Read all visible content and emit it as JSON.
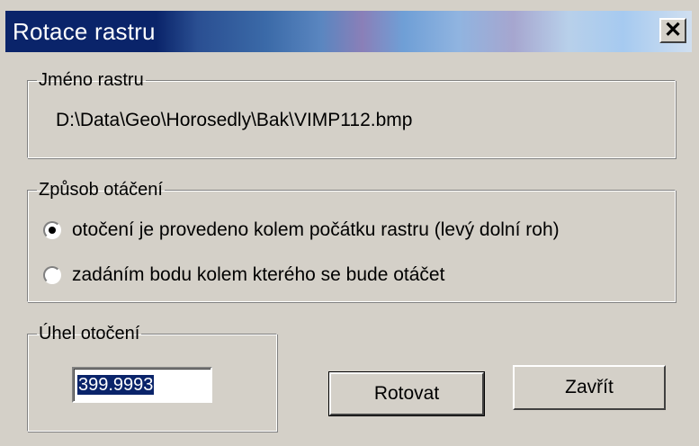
{
  "window": {
    "title": "Rotace rastru",
    "close_glyph": "✕",
    "close_icon": "close-icon"
  },
  "raster_name": {
    "legend": "Jméno rastru",
    "path": "D:\\Data\\Geo\\Horosedly\\Bak\\VIMP112.bmp"
  },
  "rotation_method": {
    "legend": "Způsob otáčení",
    "options": [
      {
        "label": "otočení je provedeno kolem počátku rastru (levý dolní roh)",
        "selected": true
      },
      {
        "label": "zadáním bodu kolem kterého se bude otáčet",
        "selected": false
      }
    ]
  },
  "rotation_angle": {
    "legend": "Úhel otočení",
    "value": "399.9993"
  },
  "buttons": {
    "rotate_label": "Rotovat",
    "close_label": "Zavřít"
  },
  "colors": {
    "dialog_face": "#d4d0c8",
    "title_active": "#0a246a",
    "selection": "#0a246a"
  }
}
